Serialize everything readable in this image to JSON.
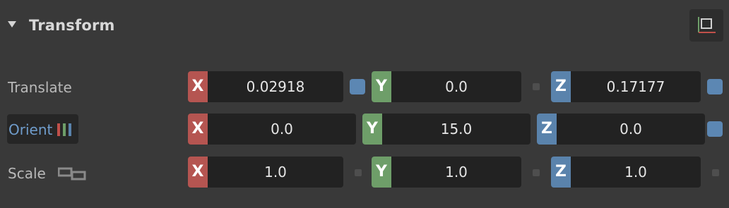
{
  "panel": {
    "title": "Transform",
    "gizmo_icon": "local-axes-icon"
  },
  "rows": {
    "translate": {
      "label": "Translate",
      "x": "0.02918",
      "y": "0.0",
      "z": "0.17177"
    },
    "orient": {
      "label": "Orient",
      "icon": "rgb-bars-icon",
      "x": "0.0",
      "y": "15.0",
      "z": "0.0"
    },
    "scale": {
      "label": "Scale",
      "icon": "link-icon",
      "x": "1.0",
      "y": "1.0",
      "z": "1.0"
    }
  },
  "axis_labels": {
    "x": "X",
    "y": "Y",
    "z": "Z"
  },
  "colors": {
    "background": "#393939",
    "field": "#222222",
    "x_axis": "#b55551",
    "y_axis": "#6e9e69",
    "z_axis": "#5a83ac",
    "orient_label": "#6f9ccb",
    "keyframe": "#5c87b3"
  }
}
